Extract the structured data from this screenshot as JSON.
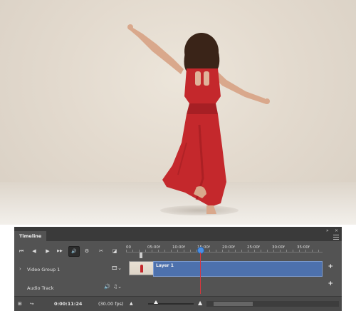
{
  "panel": {
    "tab_label": "Timeline",
    "collapse_glyph": "»",
    "close_glyph": "×"
  },
  "transport": {
    "buttons": [
      {
        "name": "go-to-first-frame-icon",
        "glyph": "⏮"
      },
      {
        "name": "previous-frame-icon",
        "glyph": "◀"
      },
      {
        "name": "play-icon",
        "glyph": "▶"
      },
      {
        "name": "next-frame-icon",
        "glyph": "▶▶"
      },
      {
        "name": "mute-audio-icon",
        "glyph": "🔊"
      },
      {
        "name": "settings-gear-icon",
        "glyph": "⚙"
      },
      {
        "name": "split-scissors-icon",
        "glyph": "✂"
      },
      {
        "name": "transition-icon",
        "glyph": "◪"
      }
    ]
  },
  "ruler": {
    "labels": [
      "00",
      "05:00f",
      "10:00f",
      "15:00f",
      "20:00f",
      "25:00f",
      "30:00f",
      "35:00f"
    ]
  },
  "tracks": {
    "video": {
      "name": "Video Group 1",
      "clip_label": "Layer 1",
      "film_icon": "film-icon"
    },
    "audio": {
      "name": "Audio Track",
      "icons": [
        "speaker-icon",
        "music-note-icon"
      ]
    }
  },
  "playhead": {
    "time_fraction": 0.31
  },
  "bottom": {
    "timecode": "0:00:11:24",
    "fps": "(30.00 fps)",
    "zoom_level": 0.17
  },
  "colors": {
    "panel_bg": "#535353",
    "clip_blue": "#4d71ad",
    "playhead_red": "#d9363e",
    "playhead_knob": "#4a90e2",
    "dress_red": "#c4282c"
  }
}
